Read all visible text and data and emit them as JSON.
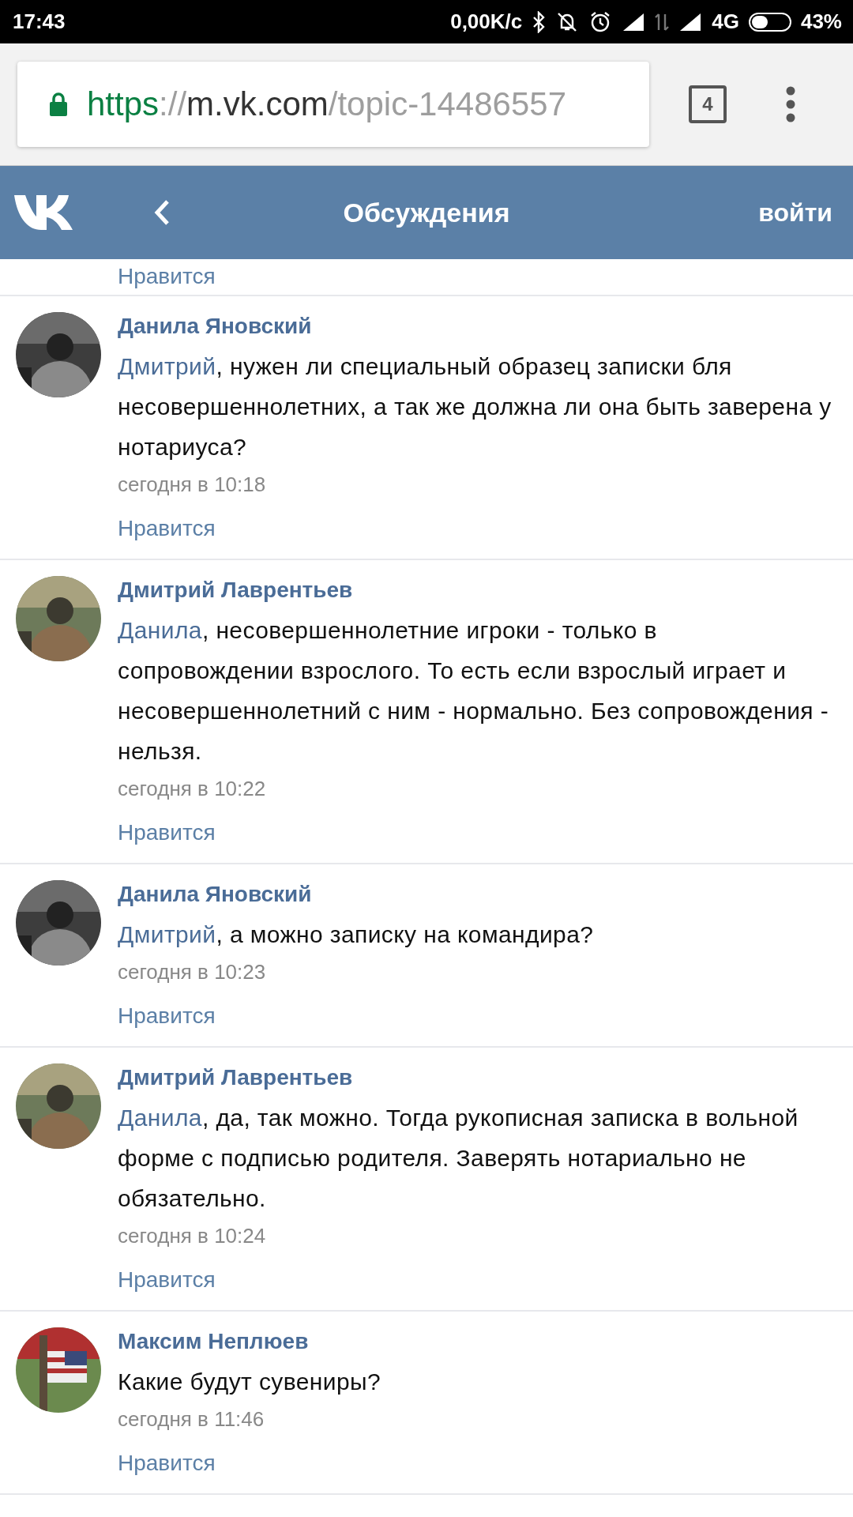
{
  "status_bar": {
    "time": "17:43",
    "speed": "0,00K/c",
    "network": "4G",
    "battery": "43%"
  },
  "browser": {
    "url": {
      "scheme": "https",
      "separator": "://",
      "host": "m.vk.com",
      "path": "/topic-14486557"
    },
    "secure": true,
    "tab_count": "4"
  },
  "header": {
    "title": "Обсуждения",
    "login": "войти"
  },
  "top_like": "Нравится",
  "posts": [
    {
      "author": "Данила Яновский",
      "mention": "Дмитрий",
      "text": ", нужен ли специальный образец записки бля несовершеннолетних, а так же должна ли она быть заверена у нотариуса?",
      "time": "сегодня в 10:18",
      "like": "Нравится"
    },
    {
      "author": "Дмитрий Лаврентьев",
      "mention": "Данила",
      "text": ", несовершеннолетние игроки - только в сопровождении взрослого. То есть если взрослый играет и несовершеннолетний с ним - нормально. Без сопровождения - нельзя.",
      "time": "сегодня в 10:22",
      "like": "Нравится"
    },
    {
      "author": "Данила Яновский",
      "mention": "Дмитрий",
      "text": ", а можно записку на командира?",
      "time": "сегодня в 10:23",
      "like": "Нравится"
    },
    {
      "author": "Дмитрий Лаврентьев",
      "mention": "Данила",
      "text": ", да, так можно. Тогда рукописная записка в вольной форме с подписью родителя. Заверять нотариально не обязательно.",
      "time": "сегодня в 10:24",
      "like": "Нравится"
    },
    {
      "author": "Максим Неплюев",
      "text": "Какие будут сувениры?",
      "time": "сегодня в 11:46",
      "like": "Нравится"
    }
  ]
}
